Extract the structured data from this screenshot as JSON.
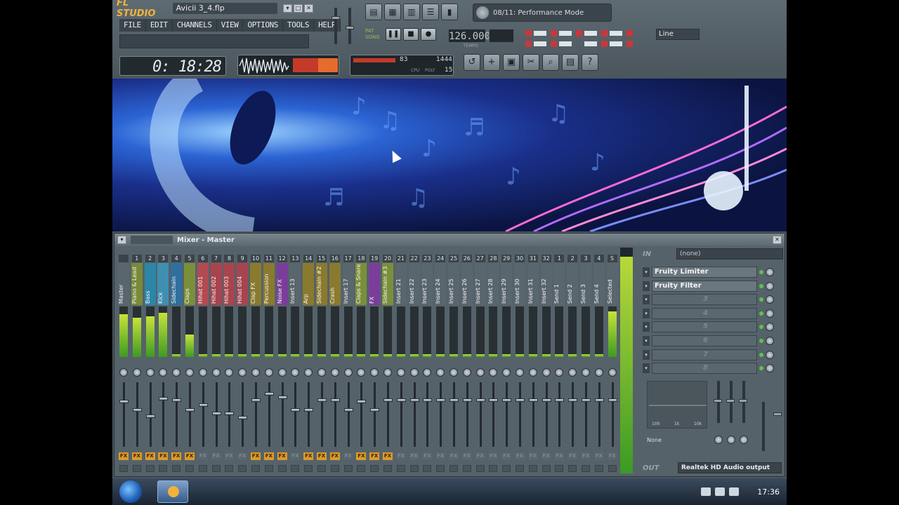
{
  "app": {
    "logo": "FL STUDIO",
    "filename": "Avicii 3_4.flp",
    "menu": [
      "FILE",
      "EDIT",
      "CHANNELS",
      "VIEW",
      "OPTIONS",
      "TOOLS",
      "HELP"
    ]
  },
  "hint_panel": {
    "text": "08/11: Performance Mode"
  },
  "transport": {
    "tempo": "126.000",
    "tempo_label": "TEMPO",
    "pat_label": "PAT",
    "song_label": "SONG",
    "snap_value": "Line"
  },
  "time_display": {
    "value": "0: 18:28"
  },
  "cpu": {
    "a": "83",
    "b": "1444",
    "c": "15",
    "cpu_label": "CPU",
    "poly_label": "POLY"
  },
  "mixer": {
    "title": "Mixer - Master",
    "strips": [
      {
        "num": "",
        "name": "Master",
        "color": "#5a666d",
        "fill": 0.85,
        "fx": true,
        "fader": 0.72
      },
      {
        "num": "1",
        "name": "Piano & Lead",
        "color": "#7a8a3a",
        "fill": 0.78,
        "fx": true,
        "fader": 0.58
      },
      {
        "num": "2",
        "name": "Bass",
        "color": "#2c86a8",
        "fill": 0.8,
        "fx": true,
        "fader": 0.48
      },
      {
        "num": "3",
        "name": "Kick",
        "color": "#3f8fb3",
        "fill": 0.88,
        "fx": true,
        "fader": 0.76
      },
      {
        "num": "4",
        "name": "Sidechain",
        "color": "#2f6f9f",
        "fill": 0.05,
        "fx": true,
        "fader": 0.74
      },
      {
        "num": "5",
        "name": "Claps",
        "color": "#7b8f3a",
        "fill": 0.45,
        "fx": true,
        "fader": 0.58
      },
      {
        "num": "6",
        "name": "Hihat 001",
        "color": "#b24a52",
        "fill": 0.05,
        "fx": false,
        "fader": 0.66
      },
      {
        "num": "7",
        "name": "Hihat 002",
        "color": "#a8444e",
        "fill": 0.05,
        "fx": false,
        "fader": 0.52
      },
      {
        "num": "8",
        "name": "Hihat 003",
        "color": "#a8444e",
        "fill": 0.05,
        "fx": false,
        "fader": 0.52
      },
      {
        "num": "9",
        "name": "Hihat 004",
        "color": "#a8444e",
        "fill": 0.05,
        "fx": false,
        "fader": 0.46
      },
      {
        "num": "10",
        "name": "Clap FX",
        "color": "#8a7a2e",
        "fill": 0.05,
        "fx": true,
        "fader": 0.74
      },
      {
        "num": "11",
        "name": "Percussion",
        "color": "#8a7a2e",
        "fill": 0.05,
        "fx": true,
        "fader": 0.84
      },
      {
        "num": "12",
        "name": "Noise FX",
        "color": "#7a3e9a",
        "fill": 0.05,
        "fx": true,
        "fader": 0.78
      },
      {
        "num": "13",
        "name": "Insert 13",
        "color": "#5a666d",
        "fill": 0.05,
        "fx": false,
        "fader": 0.58
      },
      {
        "num": "14",
        "name": "Arp",
        "color": "#8a7a2e",
        "fill": 0.05,
        "fx": true,
        "fader": 0.58
      },
      {
        "num": "15",
        "name": "Sidechain #2",
        "color": "#8a7a2e",
        "fill": 0.05,
        "fx": true,
        "fader": 0.74
      },
      {
        "num": "16",
        "name": "Crash",
        "color": "#8a7a2e",
        "fill": 0.05,
        "fx": true,
        "fader": 0.74
      },
      {
        "num": "17",
        "name": "Insert 17",
        "color": "#5a666d",
        "fill": 0.05,
        "fx": false,
        "fader": 0.58
      },
      {
        "num": "18",
        "name": "Claps & Snare",
        "color": "#7b8f3a",
        "fill": 0.05,
        "fx": true,
        "fader": 0.72
      },
      {
        "num": "19",
        "name": "FX",
        "color": "#7a3e9a",
        "fill": 0.05,
        "fx": true,
        "fader": 0.58
      },
      {
        "num": "20",
        "name": "Sidechain #3",
        "color": "#7b8f3a",
        "fill": 0.05,
        "fx": true,
        "fader": 0.74
      },
      {
        "num": "21",
        "name": "Insert 21",
        "color": "#5a666d",
        "fill": 0.05,
        "fx": false,
        "fader": 0.74
      },
      {
        "num": "22",
        "name": "Insert 22",
        "color": "#5a666d",
        "fill": 0.05,
        "fx": false,
        "fader": 0.74
      },
      {
        "num": "23",
        "name": "Insert 23",
        "color": "#5a666d",
        "fill": 0.05,
        "fx": false,
        "fader": 0.74
      },
      {
        "num": "24",
        "name": "Insert 24",
        "color": "#5a666d",
        "fill": 0.05,
        "fx": false,
        "fader": 0.74
      },
      {
        "num": "25",
        "name": "Insert 25",
        "color": "#5a666d",
        "fill": 0.05,
        "fx": false,
        "fader": 0.74
      },
      {
        "num": "26",
        "name": "Insert 26",
        "color": "#5a666d",
        "fill": 0.05,
        "fx": false,
        "fader": 0.74
      },
      {
        "num": "27",
        "name": "Insert 27",
        "color": "#5a666d",
        "fill": 0.05,
        "fx": false,
        "fader": 0.74
      },
      {
        "num": "28",
        "name": "Insert 28",
        "color": "#5a666d",
        "fill": 0.05,
        "fx": false,
        "fader": 0.74
      },
      {
        "num": "29",
        "name": "Insert 29",
        "color": "#5a666d",
        "fill": 0.05,
        "fx": false,
        "fader": 0.74
      },
      {
        "num": "30",
        "name": "Insert 30",
        "color": "#5a666d",
        "fill": 0.05,
        "fx": false,
        "fader": 0.74
      },
      {
        "num": "31",
        "name": "Insert 31",
        "color": "#5a666d",
        "fill": 0.05,
        "fx": false,
        "fader": 0.74
      },
      {
        "num": "32",
        "name": "Insert 32",
        "color": "#5a666d",
        "fill": 0.05,
        "fx": false,
        "fader": 0.74
      },
      {
        "num": "1",
        "name": "Send 1",
        "color": "#5a666d",
        "fill": 0.05,
        "fx": false,
        "fader": 0.74
      },
      {
        "num": "2",
        "name": "Send 2",
        "color": "#5a666d",
        "fill": 0.05,
        "fx": false,
        "fader": 0.74
      },
      {
        "num": "3",
        "name": "Send 3",
        "color": "#5a666d",
        "fill": 0.05,
        "fx": false,
        "fader": 0.74
      },
      {
        "num": "4",
        "name": "Send 4",
        "color": "#5a666d",
        "fill": 0.05,
        "fx": false,
        "fader": 0.74
      },
      {
        "num": "S",
        "name": "Selected",
        "color": "#5a666d",
        "fill": 0.9,
        "fx": false,
        "fader": 0.74
      }
    ],
    "fx_panel": {
      "in_label": "IN",
      "in_value": "(none)",
      "slots": [
        "Fruity Limiter",
        "Fruity Filter",
        "3",
        "4",
        "5",
        "6",
        "7",
        "8"
      ],
      "eq_labels": [
        "100",
        "1k",
        "10k"
      ],
      "send_value": "None",
      "out_label": "OUT",
      "out_value": "Realtek HD Audio output"
    }
  },
  "taskbar": {
    "clock": "17:36"
  }
}
